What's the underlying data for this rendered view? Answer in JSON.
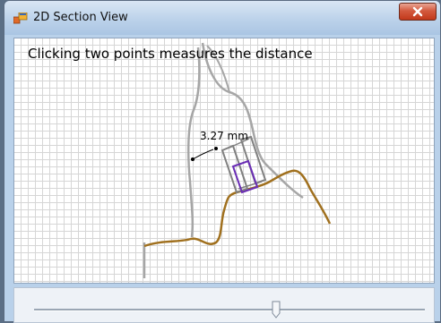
{
  "window": {
    "title": "2D Section View",
    "close_icon": "close-icon",
    "app_icon": "window-icon"
  },
  "canvas": {
    "instruction": "Clicking two points measures the distance",
    "measurement_label": "3.27 mm",
    "colors": {
      "outline": "#a6a6a6",
      "bone_line": "#a0701e",
      "implant": "#808080",
      "implant_highlight": "#6a2db5",
      "grid": "#d6d6d6"
    }
  },
  "slider": {
    "value_fraction": 0.62
  }
}
